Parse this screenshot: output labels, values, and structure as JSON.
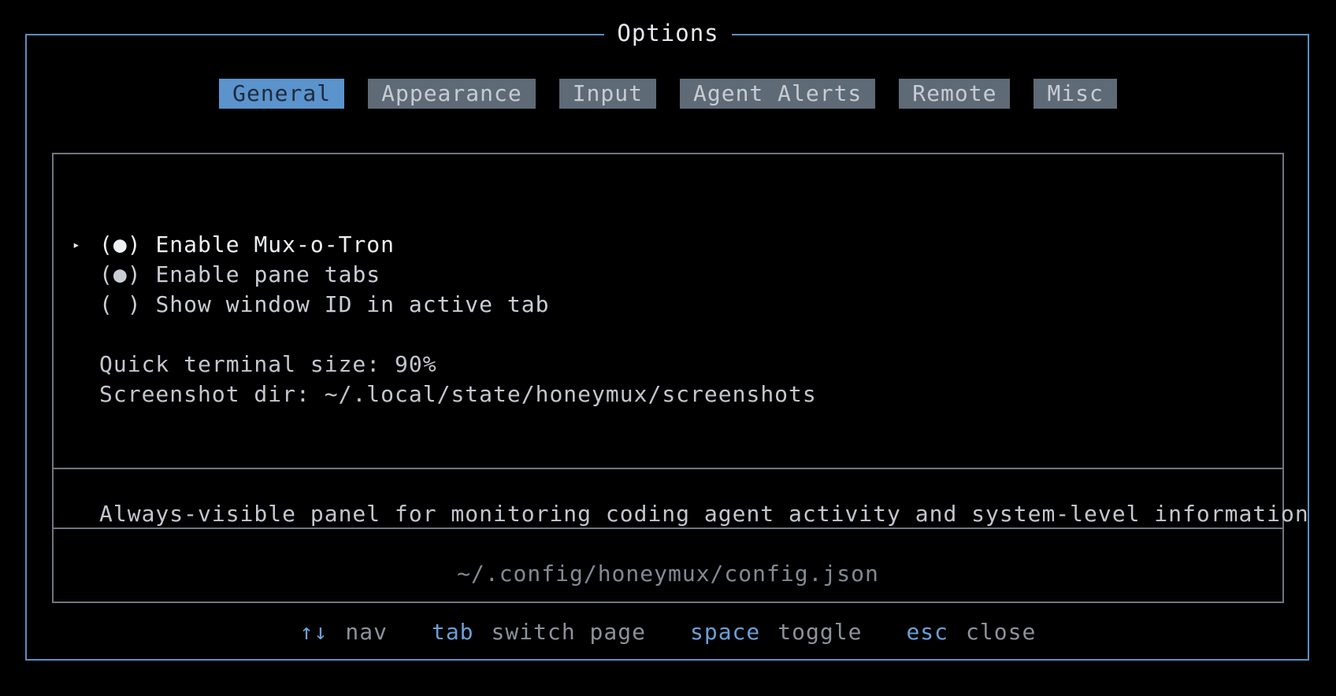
{
  "dialog": {
    "title": "Options"
  },
  "tabs": [
    {
      "label": "General",
      "active": true
    },
    {
      "label": "Appearance",
      "active": false
    },
    {
      "label": "Input",
      "active": false
    },
    {
      "label": "Agent Alerts",
      "active": false
    },
    {
      "label": "Remote",
      "active": false
    },
    {
      "label": "Misc",
      "active": false
    }
  ],
  "options": {
    "cursor_glyph": "▸",
    "toggles": [
      {
        "state": "(●)",
        "label": "Enable Mux-o-Tron",
        "checked": true,
        "focused": true
      },
      {
        "state": "(●)",
        "label": "Enable pane tabs",
        "checked": true,
        "focused": false
      },
      {
        "state": "( )",
        "label": "Show window ID in active tab",
        "checked": false,
        "focused": false
      }
    ],
    "settings": [
      {
        "label": "Quick terminal size:",
        "value": "90%"
      },
      {
        "label": "Screenshot dir:",
        "value": "~/.local/state/honeymux/screenshots"
      }
    ]
  },
  "description": "Always-visible panel for monitoring coding agent activity and system-level information",
  "config_path": "~/.config/honeymux/config.json",
  "footer": {
    "hints": [
      {
        "key": "↑↓",
        "action": "nav"
      },
      {
        "key": "tab",
        "action": "switch page"
      },
      {
        "key": "space",
        "action": "toggle"
      },
      {
        "key": "esc",
        "action": "close"
      }
    ]
  },
  "colors": {
    "accent": "#5b93cd",
    "frame": "#5b8ec4",
    "tab_inactive": "#5e6a76",
    "inner_border": "#6f7680",
    "background": "#000000"
  }
}
